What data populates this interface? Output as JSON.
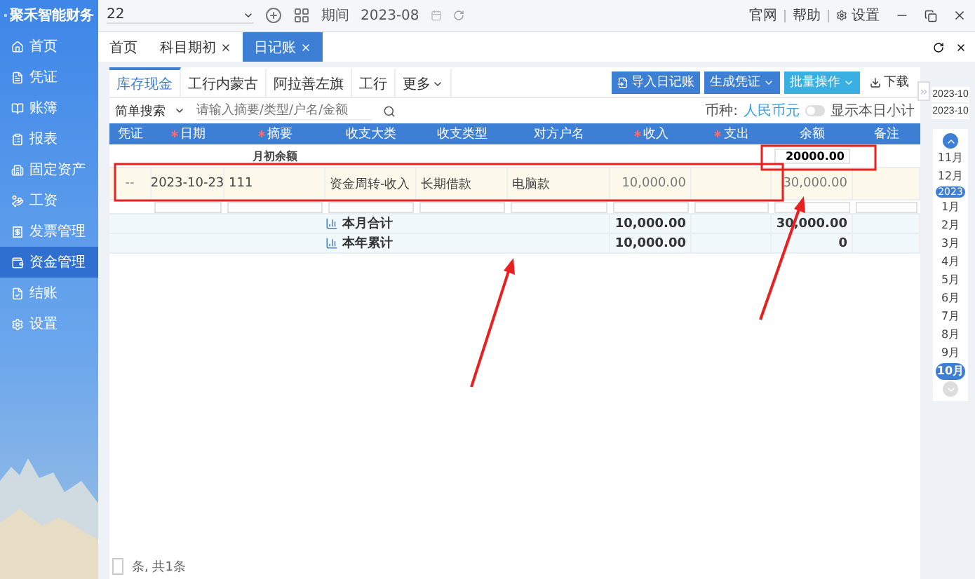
{
  "sidebar": {
    "logo": "聚禾智能财务",
    "items": [
      {
        "label": "首页",
        "selected": false
      },
      {
        "label": "凭证",
        "selected": false
      },
      {
        "label": "账簿",
        "selected": false
      },
      {
        "label": "报表",
        "selected": false
      },
      {
        "label": "固定资产",
        "selected": false
      },
      {
        "label": "工资",
        "selected": false
      },
      {
        "label": "发票管理",
        "selected": false
      },
      {
        "label": "资金管理",
        "selected": true
      },
      {
        "label": "结账",
        "selected": false
      },
      {
        "label": "设置",
        "selected": false
      }
    ]
  },
  "topbar": {
    "account": "22",
    "period_label": "期间",
    "period": "2023-08",
    "links": [
      "官网",
      "帮助",
      "设置"
    ]
  },
  "page_tabs": [
    {
      "label": "首页",
      "closable": false,
      "selected": false
    },
    {
      "label": "科目期初",
      "closable": true,
      "selected": false
    },
    {
      "label": "日记账",
      "closable": true,
      "selected": true
    }
  ],
  "account_tabs": [
    {
      "label": "库存现金",
      "selected": true,
      "dropdown": false
    },
    {
      "label": "工行内蒙古",
      "selected": false,
      "dropdown": false
    },
    {
      "label": "阿拉善左旗",
      "selected": false,
      "dropdown": false
    },
    {
      "label": "工行",
      "selected": false,
      "dropdown": false
    },
    {
      "label": "更多",
      "selected": false,
      "dropdown": true
    }
  ],
  "actions": [
    {
      "label": "导入日记账",
      "kind": "import"
    },
    {
      "label": "生成凭证",
      "kind": "menu"
    },
    {
      "label": "批量操作",
      "kind": "menu-light"
    },
    {
      "label": "下载",
      "kind": "download"
    }
  ],
  "search": {
    "mode": "简单搜索",
    "placeholder": "请输入摘要/类型/户名/金额"
  },
  "currency": {
    "label": "币种:",
    "value": "人民币元"
  },
  "daily_subtotal": {
    "label": "显示本日小计",
    "on": false
  },
  "table": {
    "columns": [
      {
        "label": "凭证",
        "required": false
      },
      {
        "label": "日期",
        "required": true
      },
      {
        "label": "摘要",
        "required": true
      },
      {
        "label": "收支大类",
        "required": false
      },
      {
        "label": "收支类型",
        "required": false
      },
      {
        "label": "对方户名",
        "required": false
      },
      {
        "label": "收入",
        "required": true
      },
      {
        "label": "支出",
        "required": true
      },
      {
        "label": "余额",
        "required": false
      },
      {
        "label": "备注",
        "required": false
      }
    ],
    "opening": {
      "label": "月初余额",
      "balance": "20000.00"
    },
    "rows": [
      {
        "voucher": "--",
        "date": "2023-10-23",
        "summary": "111",
        "category": "资金周转-收入",
        "type": "长期借款",
        "counterparty": "电脑款",
        "income": "10,000.00",
        "balance": "30,000.00"
      }
    ],
    "totals": [
      {
        "label": "本月合计",
        "income": "10,000.00",
        "balance": "30,000.00"
      },
      {
        "label": "本年累计",
        "income": "10,000.00",
        "balance": "0"
      }
    ]
  },
  "pager": {
    "text": "条, 共1条"
  },
  "period_panel": {
    "range": [
      "2023-10",
      "2023-10"
    ],
    "months": [
      {
        "kind": "month",
        "label": "11月",
        "selected": false
      },
      {
        "kind": "month",
        "label": "12月",
        "selected": false
      },
      {
        "kind": "year",
        "label": "2023"
      },
      {
        "kind": "month",
        "label": "1月",
        "selected": false
      },
      {
        "kind": "month",
        "label": "2月",
        "selected": false
      },
      {
        "kind": "month",
        "label": "3月",
        "selected": false
      },
      {
        "kind": "month",
        "label": "4月",
        "selected": false
      },
      {
        "kind": "month",
        "label": "5月",
        "selected": false
      },
      {
        "kind": "month",
        "label": "6月",
        "selected": false
      },
      {
        "kind": "month",
        "label": "7月",
        "selected": false
      },
      {
        "kind": "month",
        "label": "8月",
        "selected": false
      },
      {
        "kind": "month",
        "label": "9月",
        "selected": false
      },
      {
        "kind": "month",
        "label": "10月",
        "selected": true
      }
    ]
  }
}
